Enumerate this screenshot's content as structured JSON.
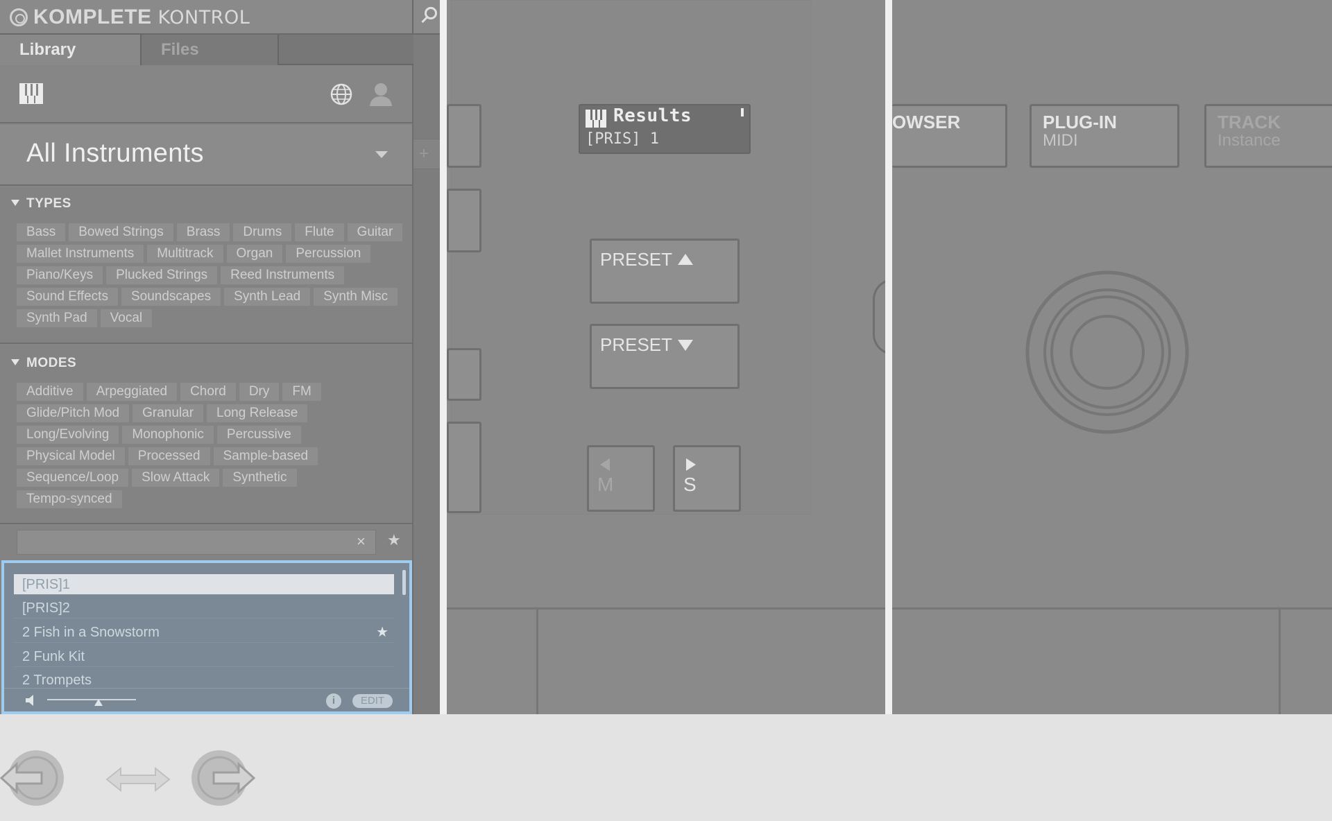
{
  "app": {
    "title_bold": "KOMPLETE",
    "title_light": "KONTROL",
    "icons": [
      "komplete-logo-icon",
      "search-icon"
    ]
  },
  "tabs": [
    {
      "label": "Library",
      "active": true
    },
    {
      "label": "Files",
      "active": false
    }
  ],
  "content_icons": [
    "piano-keys-icon",
    "globe-icon",
    "user-icon"
  ],
  "selector": {
    "label": "All Instruments"
  },
  "types": {
    "heading": "TYPES",
    "tags": [
      "Bass",
      "Bowed Strings",
      "Brass",
      "Drums",
      "Flute",
      "Guitar",
      "Mallet Instruments",
      "Multitrack",
      "Organ",
      "Percussion",
      "Piano/Keys",
      "Plucked Strings",
      "Reed Instruments",
      "Sound Effects",
      "Soundscapes",
      "Synth Lead",
      "Synth Misc",
      "Synth Pad",
      "Vocal"
    ]
  },
  "modes": {
    "heading": "MODES",
    "tags": [
      "Additive",
      "Arpeggiated",
      "Chord",
      "Dry",
      "FM",
      "Glide/Pitch Mod",
      "Granular",
      "Long Release",
      "Long/Evolving",
      "Monophonic",
      "Percussive",
      "Physical Model",
      "Processed",
      "Sample-based",
      "Sequence/Loop",
      "Slow Attack",
      "Synthetic",
      "Tempo-synced"
    ]
  },
  "search": {
    "value": "",
    "clear_glyph": "×",
    "favorite_glyph": "★"
  },
  "results": [
    {
      "name": "[PRIS]1",
      "selected": true,
      "favorite": false
    },
    {
      "name": "[PRIS]2",
      "selected": false,
      "favorite": false
    },
    {
      "name": "2 Fish in a Snowstorm",
      "selected": false,
      "favorite": true
    },
    {
      "name": "2 Funk Kit",
      "selected": false,
      "favorite": false
    },
    {
      "name": "2 Trompets",
      "selected": false,
      "favorite": false
    }
  ],
  "footer": {
    "info_label": "i",
    "edit_label": "EDIT",
    "volume": 0.58
  },
  "sidebar_strip": {
    "plus": "+"
  },
  "display": {
    "title": "Results",
    "subtitle": "[PRIS] 1"
  },
  "hardware": {
    "preset_up": "PRESET",
    "preset_down": "PRESET",
    "m_label": "M",
    "s_label": "S",
    "browser_label": "OWSER",
    "plugin_label": "PLUG-IN",
    "plugin_sub": "MIDI",
    "track_label": "TRACK",
    "track_sub": "Instance"
  },
  "nav": {
    "icons": [
      "back-arrow-icon",
      "swap-arrow-icon",
      "forward-arrow-icon"
    ]
  },
  "colors": {
    "background": "#e3e3e3",
    "panel": "#858585",
    "hardware": "#8a8a8a",
    "results_highlight": "#9fcbef",
    "results_bg": "#7a8995"
  }
}
